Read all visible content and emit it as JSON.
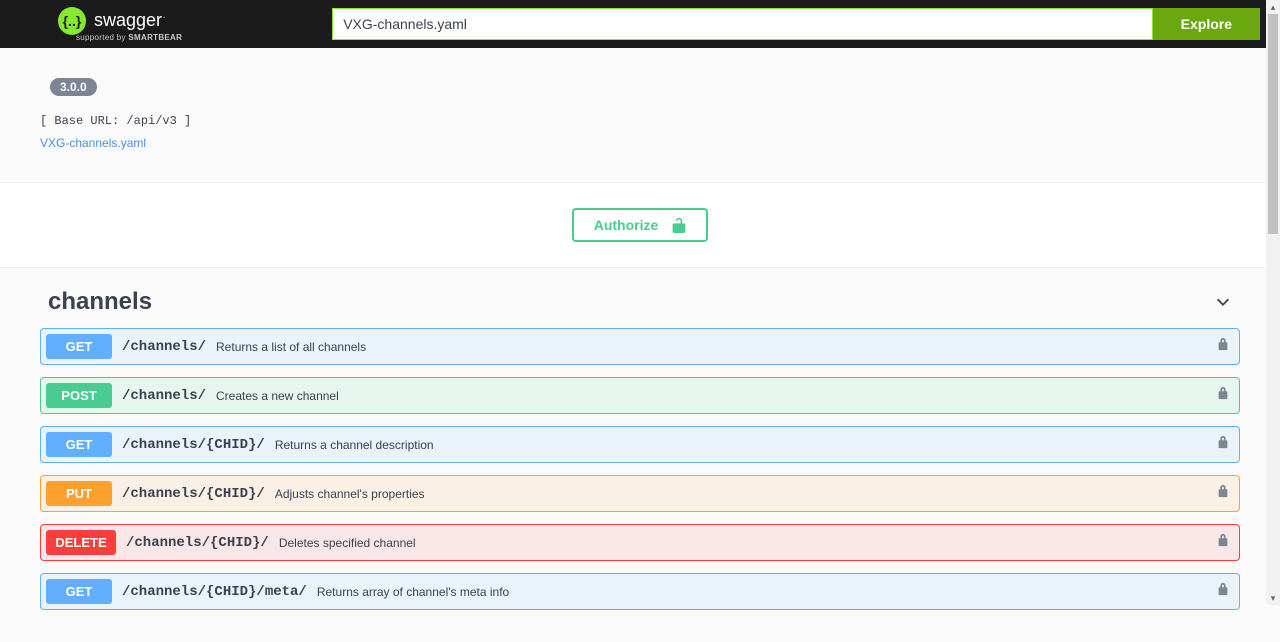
{
  "topbar": {
    "brand_title": "swagger",
    "brand_sub_prefix": "supported by ",
    "brand_sub_bold": "SMARTBEAR",
    "url_value": "VXG-channels.yaml",
    "explore_label": "Explore"
  },
  "info": {
    "oas_version": "3.0.0",
    "base_url_text": "[ Base URL: /api/v3 ]",
    "yaml_link": "VXG-channels.yaml"
  },
  "auth": {
    "authorize_label": "Authorize"
  },
  "tag": {
    "name": "channels"
  },
  "operations": [
    {
      "method": "GET",
      "mclass": "m-get",
      "rclass": "op-get",
      "path": "/channels/",
      "desc": "Returns a list of all channels"
    },
    {
      "method": "POST",
      "mclass": "m-post",
      "rclass": "op-post",
      "path": "/channels/",
      "desc": "Creates a new channel"
    },
    {
      "method": "GET",
      "mclass": "m-get",
      "rclass": "op-get",
      "path": "/channels/{CHID}/",
      "desc": "Returns a channel description"
    },
    {
      "method": "PUT",
      "mclass": "m-put",
      "rclass": "op-put",
      "path": "/channels/{CHID}/",
      "desc": "Adjusts channel's properties"
    },
    {
      "method": "DELETE",
      "mclass": "m-delete",
      "rclass": "op-delete",
      "path": "/channels/{CHID}/",
      "desc": "Deletes specified channel"
    },
    {
      "method": "GET",
      "mclass": "m-get",
      "rclass": "op-get",
      "path": "/channels/{CHID}/meta/",
      "desc": "Returns array of channel's meta info"
    }
  ]
}
